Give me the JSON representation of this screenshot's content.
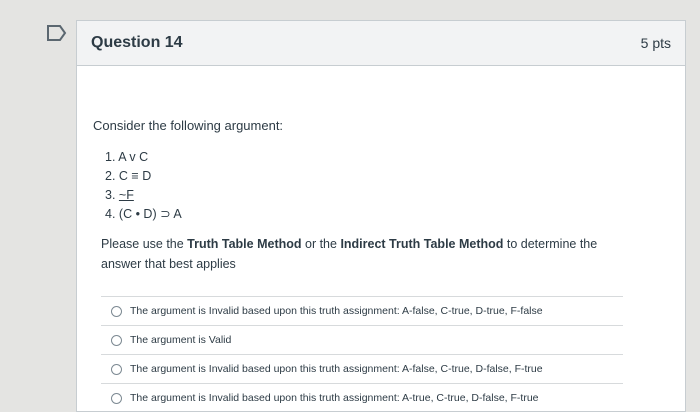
{
  "question": {
    "title": "Question 14",
    "points": "5 pts",
    "intro": "Consider the following argument:",
    "premises": [
      {
        "num": "1.",
        "text": "A v C"
      },
      {
        "num": "2.",
        "text": "C ≡ D"
      },
      {
        "num": "3.",
        "text": "~F"
      },
      {
        "num": "4.",
        "text": "(C • D) ⊃ A"
      }
    ],
    "instruction_part1": "Please use the ",
    "instruction_bold1": "Truth Table Method",
    "instruction_part2": " or the ",
    "instruction_bold2": "Indirect Truth Table Method",
    "instruction_part3": " to determine the answer that best applies"
  },
  "answers": [
    {
      "label": "The argument is Invalid based upon this truth assignment: A-false, C-true, D-true, F-false"
    },
    {
      "label": "The argument is Valid"
    },
    {
      "label": "The argument is Invalid based upon this truth assignment: A-false, C-true, D-false, F-true"
    },
    {
      "label": "The argument is Invalid based upon this truth assignment: A-true, C-true, D-false, F-true"
    }
  ]
}
